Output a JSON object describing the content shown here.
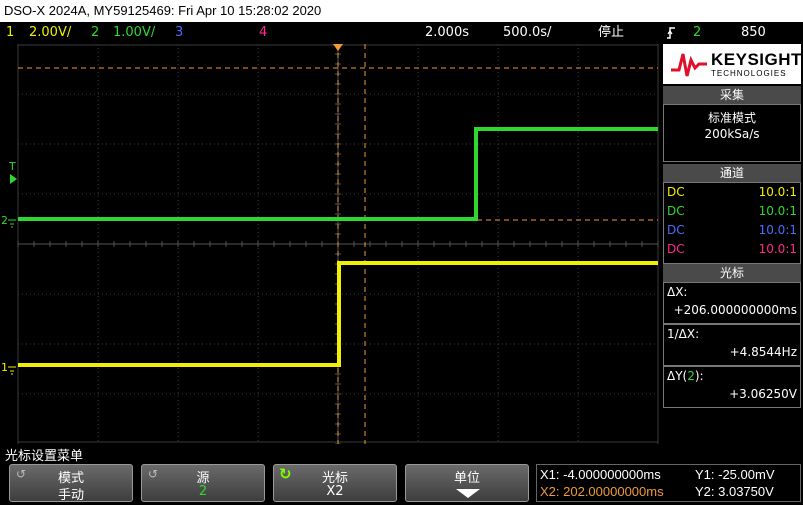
{
  "title": "DSO-X 2024A, MY59125469: Fri Apr 10 15:28:02 2020",
  "status": {
    "ch1_num": "1",
    "ch1_scale": "2.00V/",
    "ch2_num": "2",
    "ch2_scale": "1.00V/",
    "ch3_num": "3",
    "ch4_num": "4",
    "time_pos": "2.000s",
    "time_scale": "500.0s/",
    "run_state": "停止",
    "trigger_source": "2",
    "trigger_level": "850",
    "trigger_icon": "rising-edge-icon"
  },
  "colors": {
    "ch1": "#f0f000",
    "ch2": "#2ed82e",
    "ch3": "#4a6cff",
    "ch4": "#ff2a8a",
    "cursor": "#f09a3a"
  },
  "brand": {
    "name": "KEYSIGHT",
    "sub": "TECHNOLOGIES"
  },
  "acquire": {
    "header": "采集",
    "mode": "标准模式",
    "rate": "200kSa/s"
  },
  "channels": {
    "header": "通道",
    "rows": [
      {
        "coupling": "DC",
        "probe": "10.0:1"
      },
      {
        "coupling": "DC",
        "probe": "10.0:1"
      },
      {
        "coupling": "DC",
        "probe": "10.0:1"
      },
      {
        "coupling": "DC",
        "probe": "10.0:1"
      }
    ]
  },
  "cursors": {
    "header": "光标",
    "dx_label": "ΔX:",
    "dx_value": "+206.000000000ms",
    "inv_dx_label": "1/ΔX:",
    "inv_dx_value": "+4.8544Hz",
    "dy_label_pre": "ΔY(",
    "dy_label_ch": "2",
    "dy_label_post": "):",
    "dy_value": "+3.06250V"
  },
  "menu": {
    "title": "光标设置菜单",
    "softkeys": [
      {
        "label": "模式",
        "value": "手动"
      },
      {
        "label": "源",
        "value": "2"
      },
      {
        "label": "光标",
        "value": "X2"
      },
      {
        "label": "单位",
        "value": ""
      }
    ]
  },
  "readout": {
    "x1": "X1: -4.000000000ms",
    "x2": "X2: 202.00000000ms",
    "y1": "Y1: -25.00mV",
    "y2": "Y2: 3.03750V"
  },
  "markers": {
    "trigger_T": "T",
    "ch2_marker": "2",
    "ch1_marker": "1"
  }
}
